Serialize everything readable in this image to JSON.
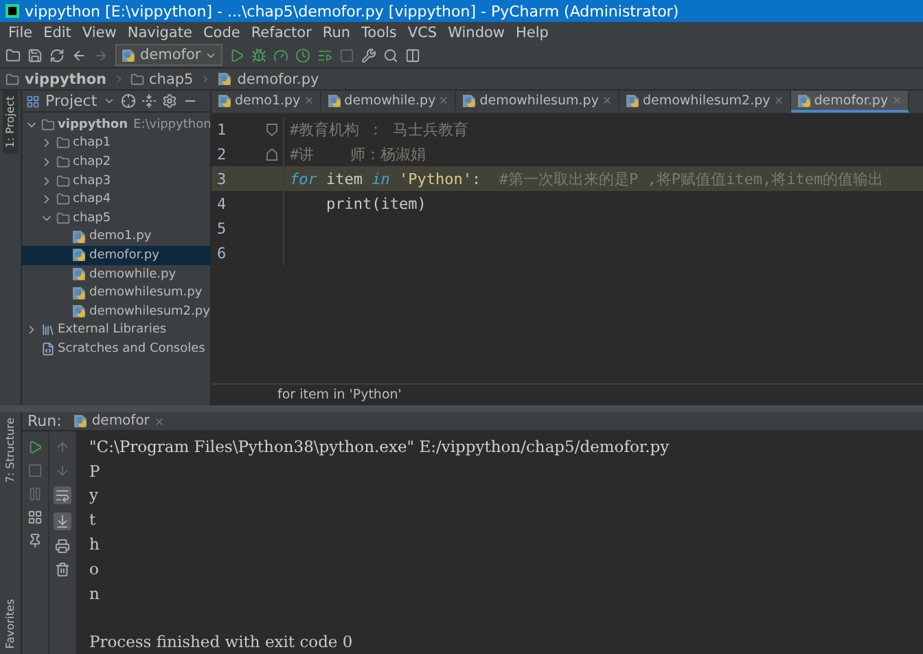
{
  "window": {
    "title": "vippython [E:\\vippython] - ...\\chap5\\demofor.py [vippython] - PyCharm (Administrator)"
  },
  "menu": [
    "File",
    "Edit",
    "View",
    "Navigate",
    "Code",
    "Refactor",
    "Run",
    "Tools",
    "VCS",
    "Window",
    "Help"
  ],
  "toolbar": {
    "run_config": "demofor"
  },
  "breadcrumbs": [
    "vippython",
    "chap5",
    "demofor.py"
  ],
  "side_tabs": {
    "top": "1: Project",
    "bottom": [
      "7: Structure",
      "Favorites"
    ]
  },
  "project": {
    "title": "Project",
    "tree": [
      {
        "label": "vippython",
        "path": "E:\\vippython",
        "kind": "folder",
        "expanded": true,
        "selected": false,
        "children": [
          {
            "label": "chap1",
            "kind": "folder",
            "expanded": false,
            "selected": false
          },
          {
            "label": "chap2",
            "kind": "folder",
            "expanded": false,
            "selected": false
          },
          {
            "label": "chap3",
            "kind": "folder",
            "expanded": false,
            "selected": false
          },
          {
            "label": "chap4",
            "kind": "folder",
            "expanded": false,
            "selected": false
          },
          {
            "label": "chap5",
            "kind": "folder",
            "expanded": true,
            "selected": false,
            "children": [
              {
                "label": "demo1.py",
                "kind": "file",
                "selected": false
              },
              {
                "label": "demofor.py",
                "kind": "file",
                "selected": true
              },
              {
                "label": "demowhile.py",
                "kind": "file",
                "selected": false
              },
              {
                "label": "demowhilesum.py",
                "kind": "file",
                "selected": false
              },
              {
                "label": "demowhilesum2.py",
                "kind": "file",
                "selected": false
              }
            ]
          }
        ]
      },
      {
        "label": "External Libraries",
        "kind": "library",
        "expanded": false,
        "selected": false
      },
      {
        "label": "Scratches and Consoles",
        "kind": "scratch",
        "selected": false
      }
    ]
  },
  "tabs": [
    {
      "label": "demo1.py",
      "selected": false
    },
    {
      "label": "demowhile.py",
      "selected": false
    },
    {
      "label": "demowhilesum.py",
      "selected": false
    },
    {
      "label": "demowhilesum2.py",
      "selected": false
    },
    {
      "label": "demofor.py",
      "selected": true
    }
  ],
  "code": [
    {
      "number": "1",
      "current": false,
      "fold_start": true,
      "tokens": [
        {
          "text": "#教育机构 ： 马士兵教育",
          "kind": "comment"
        }
      ]
    },
    {
      "number": "2",
      "current": false,
      "fold_end": true,
      "tokens": [
        {
          "text": "#讲    师：杨淑娟",
          "kind": "comment"
        }
      ]
    },
    {
      "number": "3",
      "current": true,
      "tokens": [
        {
          "text": "for",
          "kind": "keyword"
        },
        {
          "text": " item ",
          "kind": "plain"
        },
        {
          "text": "in",
          "kind": "keyword"
        },
        {
          "text": " 'Python'",
          "kind": "string"
        },
        {
          "text": ":  ",
          "kind": "plain"
        },
        {
          "text": "#第一次取出来的是P ,将P赋值值item,将item的值输出",
          "kind": "comment"
        }
      ]
    },
    {
      "number": "4",
      "current": false,
      "tokens": [
        {
          "text": "    print(item)",
          "kind": "plain"
        }
      ]
    },
    {
      "number": "5",
      "current": false
    },
    {
      "number": "6",
      "current": false
    }
  ],
  "editor_breadcrumb": "for item in 'Python'",
  "run": {
    "label": "Run:",
    "tab": "demofor",
    "output": [
      {
        "text": "\"C:\\Program Files\\Python38\\python.exe\" E:/vippython/chap5/demofor.py",
        "kind": "command"
      },
      {
        "text": "P",
        "kind": "stdout"
      },
      {
        "text": "y",
        "kind": "stdout"
      },
      {
        "text": "t",
        "kind": "stdout"
      },
      {
        "text": "h",
        "kind": "stdout"
      },
      {
        "text": "o",
        "kind": "stdout"
      },
      {
        "text": "n",
        "kind": "stdout"
      },
      {
        "text": "Process finished with exit code 0",
        "kind": "status"
      }
    ]
  }
}
